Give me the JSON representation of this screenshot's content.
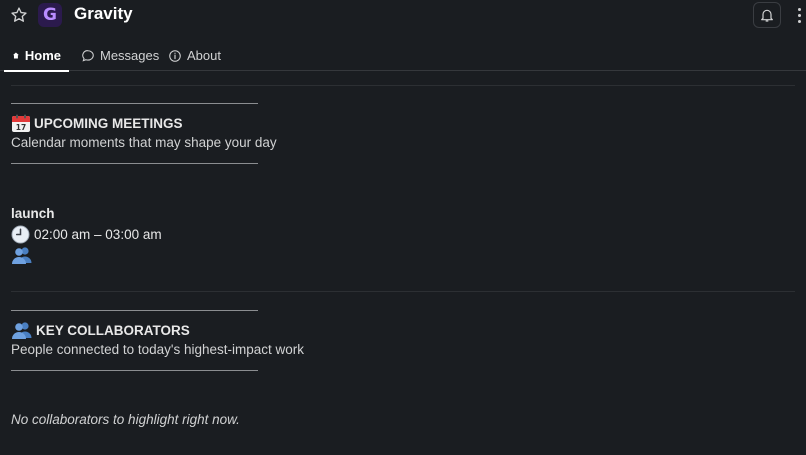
{
  "app": {
    "title": "Gravity",
    "logo_letter": "G",
    "accent_color": "#b98cff"
  },
  "header": {
    "star_icon": "star-icon",
    "bell_icon": "bell-icon",
    "more_icon": "more-vertical-icon"
  },
  "tabs": [
    {
      "label": "Home",
      "icon": "home-icon",
      "active": true
    },
    {
      "label": "Messages",
      "icon": "chat-bubble-icon",
      "active": false
    },
    {
      "label": "About",
      "icon": "info-icon",
      "active": false
    }
  ],
  "upcoming": {
    "icon": "calendar-icon",
    "title": "UPCOMING MEETINGS",
    "subtitle": "Calendar moments that may shape your day"
  },
  "meeting": {
    "name": "launch",
    "time_icon": "clock-icon",
    "time": "02:00 am – 03:00 am",
    "attendees_icon": "people-icon"
  },
  "collaborators": {
    "icon": "people-icon",
    "title": "KEY COLLABORATORS",
    "subtitle": "People connected to today's highest-impact work",
    "empty_text": "No collaborators to highlight right now."
  }
}
